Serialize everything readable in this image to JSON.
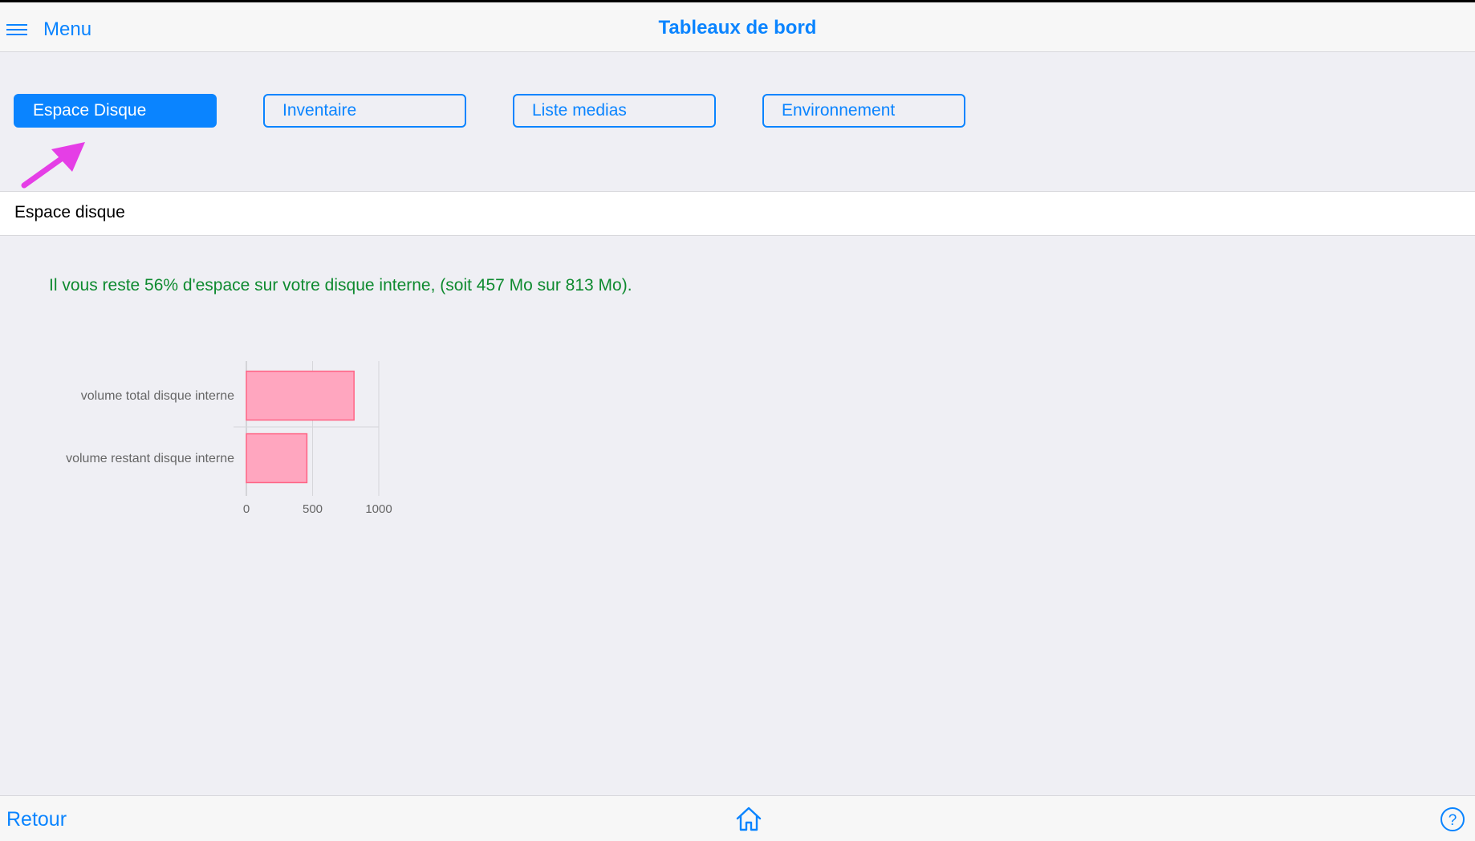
{
  "header": {
    "menu_label": "Menu",
    "title": "Tableaux de bord",
    "menu_icon": "hamburger-icon"
  },
  "tabs": [
    {
      "label": "Espace Disque",
      "active": true
    },
    {
      "label": "Inventaire",
      "active": false
    },
    {
      "label": "Liste medias",
      "active": false
    },
    {
      "label": "Environnement",
      "active": false
    }
  ],
  "section": {
    "title": "Espace disque"
  },
  "status": {
    "message": "Il vous reste 56% d'espace sur votre disque interne, (soit 457 Mo sur 813 Mo).",
    "color": "#0e8a2f"
  },
  "chart_data": {
    "type": "bar",
    "orientation": "horizontal",
    "categories": [
      "volume total disque interne",
      "volume restant disque interne"
    ],
    "values": [
      813,
      457
    ],
    "xlim": [
      0,
      1000
    ],
    "xticks": [
      "0",
      "500",
      "1000"
    ],
    "grid": true,
    "bar_color": "#ffa6bf",
    "bar_border": "#ff6384"
  },
  "footer": {
    "back_label": "Retour",
    "home_icon": "home-icon",
    "help_icon": "help-icon"
  },
  "colors": {
    "accent": "#0a84ff",
    "annotation_arrow": "#e53ee6"
  }
}
